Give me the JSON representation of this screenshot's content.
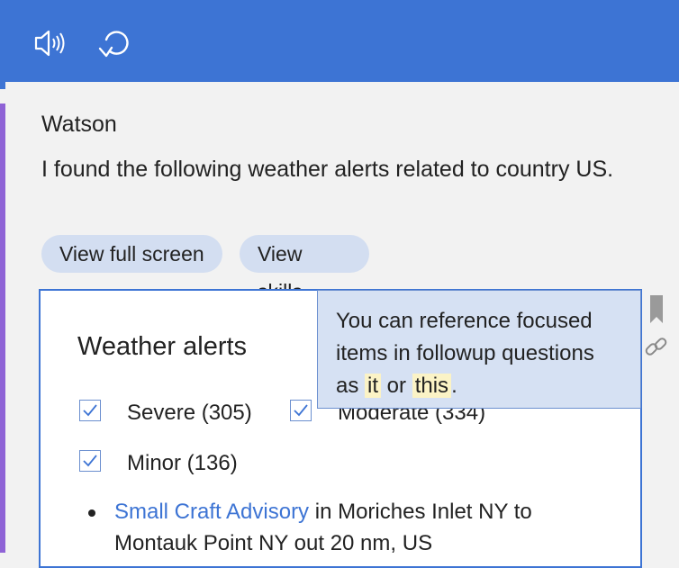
{
  "toolbar": {
    "speaker_icon": "speaker-icon",
    "refresh_icon": "refresh-icon",
    "accent_color": "#3d74d4"
  },
  "message": {
    "author": "Watson",
    "text": "I found the following weather alerts related to country US.",
    "actions": [
      "View full screen",
      "View skills"
    ]
  },
  "card": {
    "title": "Weather alerts",
    "filters": [
      {
        "label": "Severe (305)",
        "checked": true
      },
      {
        "label": "Moderate (334)",
        "checked": true
      },
      {
        "label": "Minor (136)",
        "checked": true
      }
    ],
    "alerts": [
      {
        "link": "Small Craft Advisory",
        "text": " in Moriches Inlet NY to Montauk Point NY out 20 nm, US"
      }
    ]
  },
  "tooltip": {
    "part1": "You can reference focused items in followup questions as ",
    "word1": "it",
    "part2": " or ",
    "word2": "this",
    "part3": "."
  },
  "side_icons": [
    "bookmark-icon",
    "link-icon"
  ]
}
